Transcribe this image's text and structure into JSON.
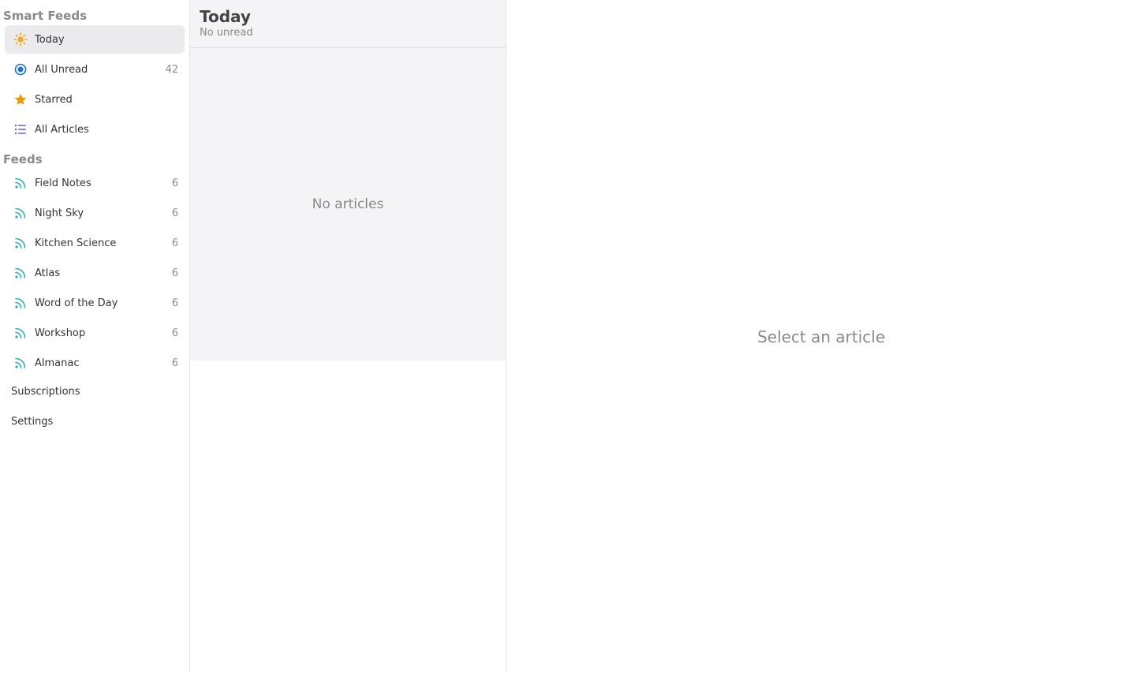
{
  "sidebar": {
    "smart_feeds_header": "Smart Feeds",
    "smart_feeds": [
      {
        "label": "Today",
        "icon": "sun-icon",
        "count": ""
      },
      {
        "label": "All Unread",
        "icon": "unread-circle-icon",
        "count": "42"
      },
      {
        "label": "Starred",
        "icon": "star-icon",
        "count": ""
      },
      {
        "label": "All Articles",
        "icon": "list-icon",
        "count": ""
      }
    ],
    "feeds_header": "Feeds",
    "feeds": [
      {
        "label": "Field Notes",
        "icon": "rss-icon",
        "count": "6"
      },
      {
        "label": "Night Sky",
        "icon": "rss-icon",
        "count": "6"
      },
      {
        "label": "Kitchen Science",
        "icon": "rss-icon",
        "count": "6"
      },
      {
        "label": "Atlas",
        "icon": "rss-icon",
        "count": "6"
      },
      {
        "label": "Word of the Day",
        "icon": "rss-icon",
        "count": "6"
      },
      {
        "label": "Workshop",
        "icon": "rss-icon",
        "count": "6"
      },
      {
        "label": "Almanac",
        "icon": "rss-icon",
        "count": "6"
      }
    ],
    "subscriptions_label": "Subscriptions",
    "settings_label": "Settings"
  },
  "article_list": {
    "title": "Today",
    "subtitle": "No unread",
    "empty_text": "No articles"
  },
  "reader": {
    "empty_text": "Select an article"
  },
  "colors": {
    "sun": "#f5a623",
    "unread": "#1a73e8",
    "star": "#e69b00",
    "list": "#6a5acd",
    "rss": "#2bb3b3"
  }
}
